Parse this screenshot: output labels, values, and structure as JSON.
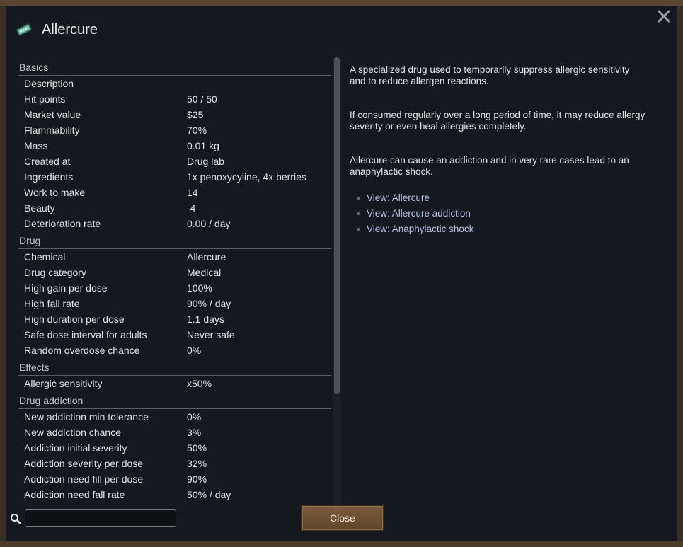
{
  "window": {
    "title": "Allercure"
  },
  "stats": [
    {
      "category": "Basics",
      "rows": [
        {
          "label": "Description",
          "value": ""
        },
        {
          "label": "Hit points",
          "value": "50 / 50"
        },
        {
          "label": "Market value",
          "value": "$25"
        },
        {
          "label": "Flammability",
          "value": "70%"
        },
        {
          "label": "Mass",
          "value": "0.01 kg"
        },
        {
          "label": "Created at",
          "value": "Drug lab"
        },
        {
          "label": "Ingredients",
          "value": "1x penoxycyline, 4x berries"
        },
        {
          "label": "Work to make",
          "value": "14"
        },
        {
          "label": "Beauty",
          "value": "-4"
        },
        {
          "label": "Deterioration rate",
          "value": "0.00 / day"
        }
      ]
    },
    {
      "category": "Drug",
      "rows": [
        {
          "label": "Chemical",
          "value": "Allercure"
        },
        {
          "label": "Drug category",
          "value": "Medical"
        },
        {
          "label": "High gain per dose",
          "value": "100%"
        },
        {
          "label": "High fall rate",
          "value": "90% / day"
        },
        {
          "label": "High duration per dose",
          "value": "1.1 days"
        },
        {
          "label": "Safe dose interval for adults",
          "value": "Never safe"
        },
        {
          "label": "Random overdose chance",
          "value": "0%"
        }
      ]
    },
    {
      "category": "Effects",
      "rows": [
        {
          "label": "Allergic sensitivity",
          "value": "x50%"
        }
      ]
    },
    {
      "category": "Drug addiction",
      "rows": [
        {
          "label": "New addiction min tolerance",
          "value": "0%"
        },
        {
          "label": "New addiction chance",
          "value": "3%"
        },
        {
          "label": "Addiction initial severity",
          "value": "50%"
        },
        {
          "label": "Addiction severity per dose",
          "value": "32%"
        },
        {
          "label": "Addiction need fill per dose",
          "value": "90%"
        },
        {
          "label": "Addiction need fall rate",
          "value": "50% / day"
        }
      ]
    }
  ],
  "description": {
    "paragraphs": [
      "A specialized drug used to temporarily suppress allergic sensitivity and to reduce allergen reactions.",
      "If consumed regularly over a long period of time, it may reduce allergy severity or even heal allergies completely.",
      "Allercure can cause an addiction and in very rare cases lead to an anaphylactic shock."
    ],
    "links": [
      "View: Allercure",
      "View: Allercure addiction",
      "View: Anaphylactic shock"
    ]
  },
  "search": {
    "value": "",
    "placeholder": ""
  },
  "buttons": {
    "close": "Close"
  },
  "icons": {
    "close": "close-x-icon",
    "item": "drug-pack-icon",
    "search": "magnifier-icon"
  },
  "colors": {
    "window_bg": "#15191f",
    "link": "#b9c3ec",
    "button": "#6e5333",
    "desk_bg": "#3a2e24"
  }
}
